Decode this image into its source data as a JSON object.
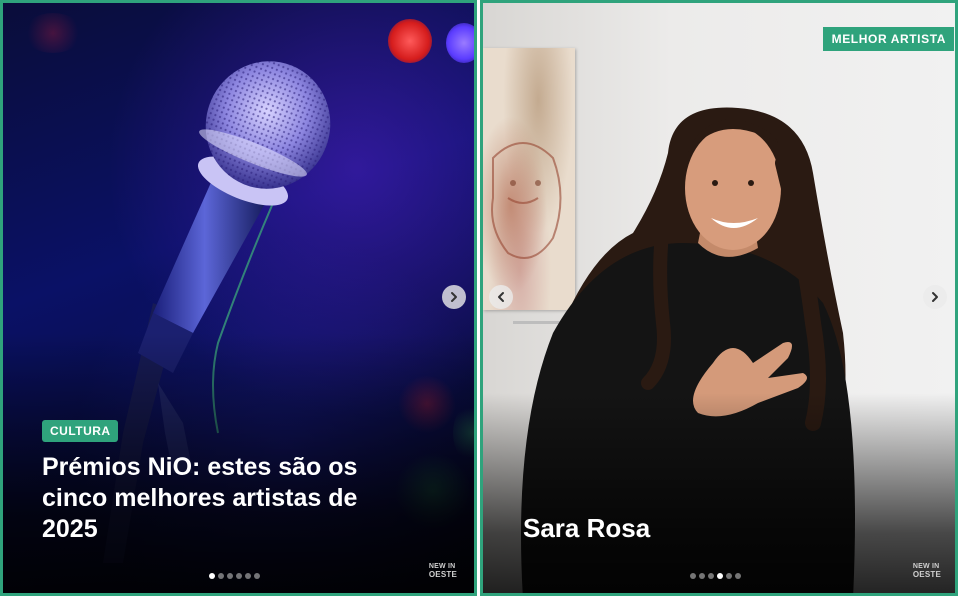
{
  "posts": [
    {
      "category": "CULTURA",
      "headline": {
        "part1": "Prémios NiO:",
        "part2": " estes são os ",
        "part3": "cinco melhores artistas",
        "part4": " de 2025"
      },
      "carousel": {
        "total_slides": 6,
        "active_index": 0
      },
      "watermark": {
        "line1": "NEW IN",
        "line2": "OESTE"
      }
    },
    {
      "badge": "MELHOR ARTISTA",
      "name": "Sara Rosa",
      "carousel": {
        "total_slides": 6,
        "active_index": 3
      },
      "watermark": {
        "line1": "NEW IN",
        "line2": "OESTE"
      }
    }
  ],
  "colors": {
    "accent": "#2fa37c"
  },
  "icons": {
    "next": "chevron-right-icon",
    "prev": "chevron-left-icon"
  }
}
